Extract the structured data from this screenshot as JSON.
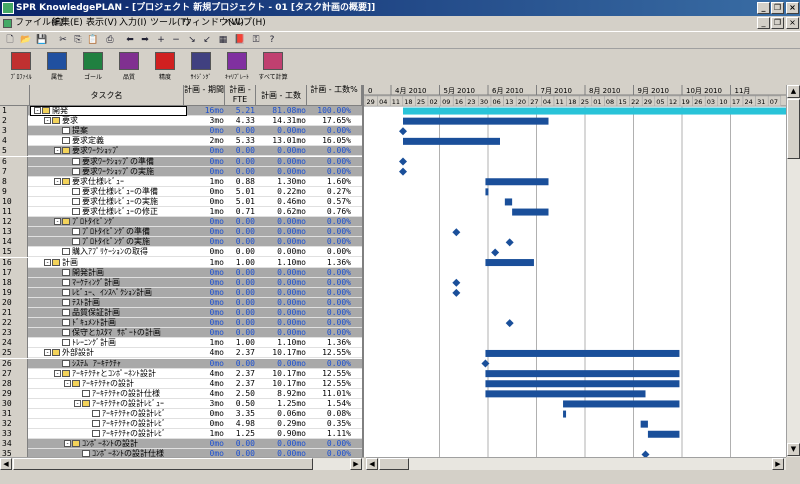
{
  "window": {
    "title": "SPR KnowledgePLAN - [プロジェクト 新規プロジェクト - 01 [タスク計画の概要]]",
    "minimize": "_",
    "restore": "❐",
    "close": "×",
    "doc_minimize": "_",
    "doc_restore": "❐",
    "doc_close": "×"
  },
  "menu": [
    {
      "label": "ファイル(F)"
    },
    {
      "label": "編集(E)"
    },
    {
      "label": "表示(V)"
    },
    {
      "label": "入力(I)"
    },
    {
      "label": "ツール(T)"
    },
    {
      "label": "ウィンドウ(W)"
    },
    {
      "label": "ヘルプ(H)"
    }
  ],
  "toolbar_icons": [
    {
      "name": "new-icon",
      "glyph": "🗋"
    },
    {
      "name": "open-icon",
      "glyph": "📂"
    },
    {
      "name": "save-icon",
      "glyph": "💾"
    },
    {
      "name": "cut-icon",
      "glyph": "✂"
    },
    {
      "name": "copy-icon",
      "glyph": "⎘"
    },
    {
      "name": "paste-icon",
      "glyph": "📋"
    },
    {
      "name": "print-icon",
      "glyph": "⎙"
    },
    {
      "name": "arrow-left-icon",
      "glyph": "⬅"
    },
    {
      "name": "arrow-right-icon",
      "glyph": "➡"
    },
    {
      "name": "add-icon",
      "glyph": "+"
    },
    {
      "name": "remove-icon",
      "glyph": "−"
    },
    {
      "name": "indent-icon",
      "glyph": "↘"
    },
    {
      "name": "outdent-icon",
      "glyph": "↙"
    },
    {
      "name": "calculator-icon",
      "glyph": "▦"
    },
    {
      "name": "book-icon",
      "glyph": "📕"
    },
    {
      "name": "key-icon",
      "glyph": "⚿"
    },
    {
      "name": "help-icon",
      "glyph": "?"
    }
  ],
  "big_buttons": [
    {
      "label": "ﾌﾟﾛﾌｧｲﾙ",
      "color": "#c03030",
      "icon": "profile-icon"
    },
    {
      "label": "属性",
      "color": "#2050a0",
      "icon": "attributes-icon"
    },
    {
      "label": "ゴール",
      "color": "#208040",
      "icon": "goal-icon"
    },
    {
      "label": "品質",
      "color": "#803090",
      "icon": "quality-icon"
    },
    {
      "label": "精度",
      "color": "#d02020",
      "icon": "precision-icon"
    },
    {
      "label": "ｻｲｼﾞﾝｸﾞ",
      "color": "#404080",
      "icon": "sizing-icon"
    },
    {
      "label": "ｷｬﾘﾌﾞﾚｰﾄ",
      "color": "#8030a0",
      "icon": "calibrate-icon"
    },
    {
      "label": "すべて計算",
      "color": "#c04070",
      "icon": "calculate-all-icon"
    }
  ],
  "grid": {
    "columns": [
      {
        "label": "タスク名"
      },
      {
        "label": "計画 - 期間"
      },
      {
        "label": "計画 - FTE"
      },
      {
        "label": "計画 - 工数"
      },
      {
        "label": "計画 - 工数%"
      }
    ],
    "rows": [
      {
        "num": "1",
        "level": 0,
        "icon": "folder",
        "exp": "-",
        "summary": true,
        "name": "開発",
        "dur": "16mo",
        "fte": "5.21",
        "work": "81.08mo",
        "pct": "100.00%"
      },
      {
        "num": "2",
        "level": 1,
        "icon": "folder",
        "exp": "-",
        "summary": false,
        "name": "要求",
        "dur": "3mo",
        "fte": "4.33",
        "work": "14.31mo",
        "pct": "17.65%"
      },
      {
        "num": "3",
        "level": 2,
        "icon": "doc",
        "exp": "",
        "summary": true,
        "name": "提案",
        "dur": "0mo",
        "fte": "0.00",
        "work": "0.00mo",
        "pct": "0.00%"
      },
      {
        "num": "4",
        "level": 2,
        "icon": "doc",
        "exp": "",
        "summary": false,
        "name": "要求定義",
        "dur": "2mo",
        "fte": "5.33",
        "work": "13.01mo",
        "pct": "16.05%"
      },
      {
        "num": "5",
        "level": 2,
        "icon": "folder",
        "exp": "-",
        "summary": true,
        "name": "要求ﾜｰｸｼｮｯﾌﾟ",
        "dur": "0mo",
        "fte": "0.00",
        "work": "0.00mo",
        "pct": "0.00%"
      },
      {
        "num": "6",
        "level": 3,
        "icon": "doc",
        "exp": "",
        "summary": true,
        "name": "要求ﾜｰｸｼｮｯﾌﾟの準備",
        "dur": "0mo",
        "fte": "0.00",
        "work": "0.00mo",
        "pct": "0.00%"
      },
      {
        "num": "7",
        "level": 3,
        "icon": "doc",
        "exp": "",
        "summary": true,
        "name": "要求ﾜｰｸｼｮｯﾌﾟの実施",
        "dur": "0mo",
        "fte": "0.00",
        "work": "0.00mo",
        "pct": "0.00%"
      },
      {
        "num": "8",
        "level": 2,
        "icon": "folder",
        "exp": "-",
        "summary": false,
        "name": "要求仕様ﾚﾋﾞｭｰ",
        "dur": "1mo",
        "fte": "0.88",
        "work": "1.30mo",
        "pct": "1.60%"
      },
      {
        "num": "9",
        "level": 3,
        "icon": "doc",
        "exp": "",
        "summary": false,
        "name": "要求仕様ﾚﾋﾞｭｰの準備",
        "dur": "0mo",
        "fte": "5.01",
        "work": "0.22mo",
        "pct": "0.27%"
      },
      {
        "num": "10",
        "level": 3,
        "icon": "doc",
        "exp": "",
        "summary": false,
        "name": "要求仕様ﾚﾋﾞｭｰの実施",
        "dur": "0mo",
        "fte": "5.01",
        "work": "0.46mo",
        "pct": "0.57%"
      },
      {
        "num": "11",
        "level": 3,
        "icon": "doc",
        "exp": "",
        "summary": false,
        "name": "要求仕様ﾚﾋﾞｭｰの修正",
        "dur": "1mo",
        "fte": "0.71",
        "work": "0.62mo",
        "pct": "0.76%"
      },
      {
        "num": "12",
        "level": 2,
        "icon": "folder",
        "exp": "-",
        "summary": true,
        "name": "ﾌﾟﾛﾄﾀｲﾋﾟﾝｸﾞ",
        "dur": "0mo",
        "fte": "0.00",
        "work": "0.00mo",
        "pct": "0.00%"
      },
      {
        "num": "13",
        "level": 3,
        "icon": "doc",
        "exp": "",
        "summary": true,
        "name": "ﾌﾟﾛﾄﾀｲﾋﾟﾝｸﾞの準備",
        "dur": "0mo",
        "fte": "0.00",
        "work": "0.00mo",
        "pct": "0.00%"
      },
      {
        "num": "14",
        "level": 3,
        "icon": "doc",
        "exp": "",
        "summary": true,
        "name": "ﾌﾟﾛﾄﾀｲﾋﾟﾝｸﾞの実施",
        "dur": "0mo",
        "fte": "0.00",
        "work": "0.00mo",
        "pct": "0.00%"
      },
      {
        "num": "15",
        "level": 2,
        "icon": "doc",
        "exp": "",
        "summary": false,
        "name": "購入ｱﾌﾟﾘｹｰｼｮﾝの取得",
        "dur": "0mo",
        "fte": "0.00",
        "work": "0.00mo",
        "pct": "0.00%"
      },
      {
        "num": "16",
        "level": 1,
        "icon": "folder",
        "exp": "-",
        "summary": false,
        "name": "計画",
        "dur": "1mo",
        "fte": "1.00",
        "work": "1.10mo",
        "pct": "1.36%"
      },
      {
        "num": "17",
        "level": 2,
        "icon": "doc",
        "exp": "",
        "summary": true,
        "name": "開発計画",
        "dur": "0mo",
        "fte": "0.00",
        "work": "0.00mo",
        "pct": "0.00%"
      },
      {
        "num": "18",
        "level": 2,
        "icon": "doc",
        "exp": "",
        "summary": true,
        "name": "ﾏｰｹﾃｨﾝｸﾞ計画",
        "dur": "0mo",
        "fte": "0.00",
        "work": "0.00mo",
        "pct": "0.00%"
      },
      {
        "num": "19",
        "level": 2,
        "icon": "doc",
        "exp": "",
        "summary": true,
        "name": "ﾚﾋﾞｭｰ、ｲﾝｽﾍﾟｸｼｮﾝ計画",
        "dur": "0mo",
        "fte": "0.00",
        "work": "0.00mo",
        "pct": "0.00%"
      },
      {
        "num": "20",
        "level": 2,
        "icon": "doc",
        "exp": "",
        "summary": true,
        "name": "ﾃｽﾄ計画",
        "dur": "0mo",
        "fte": "0.00",
        "work": "0.00mo",
        "pct": "0.00%"
      },
      {
        "num": "21",
        "level": 2,
        "icon": "doc",
        "exp": "",
        "summary": true,
        "name": "品質保証計画",
        "dur": "0mo",
        "fte": "0.00",
        "work": "0.00mo",
        "pct": "0.00%"
      },
      {
        "num": "22",
        "level": 2,
        "icon": "doc",
        "exp": "",
        "summary": true,
        "name": "ﾄﾞｷｭﾒﾝﾄ計画",
        "dur": "0mo",
        "fte": "0.00",
        "work": "0.00mo",
        "pct": "0.00%"
      },
      {
        "num": "23",
        "level": 2,
        "icon": "doc",
        "exp": "",
        "summary": true,
        "name": "保守とｶｽﾀﾏ ｻﾎﾟｰﾄの計画",
        "dur": "0mo",
        "fte": "0.00",
        "work": "0.00mo",
        "pct": "0.00%"
      },
      {
        "num": "24",
        "level": 2,
        "icon": "doc",
        "exp": "",
        "summary": false,
        "name": "ﾄﾚｰﾆﾝｸﾞ計画",
        "dur": "1mo",
        "fte": "1.00",
        "work": "1.10mo",
        "pct": "1.36%"
      },
      {
        "num": "25",
        "level": 1,
        "icon": "folder",
        "exp": "-",
        "summary": false,
        "name": "外部設計",
        "dur": "4mo",
        "fte": "2.37",
        "work": "10.17mo",
        "pct": "12.55%"
      },
      {
        "num": "26",
        "level": 2,
        "icon": "doc",
        "exp": "",
        "summary": true,
        "name": "ｼｽﾃﾑ ｱｰｷﾃｸﾁｬ",
        "dur": "0mo",
        "fte": "0.00",
        "work": "0.00mo",
        "pct": "0.00%"
      },
      {
        "num": "27",
        "level": 2,
        "icon": "folder",
        "exp": "-",
        "summary": false,
        "name": "ｱｰｷﾃｸﾁｬとｺﾝﾎﾟｰﾈﾝﾄ設計",
        "dur": "4mo",
        "fte": "2.37",
        "work": "10.17mo",
        "pct": "12.55%"
      },
      {
        "num": "28",
        "level": 3,
        "icon": "folder",
        "exp": "-",
        "summary": false,
        "name": "ｱｰｷﾃｸﾁｬの設計",
        "dur": "4mo",
        "fte": "2.37",
        "work": "10.17mo",
        "pct": "12.55%"
      },
      {
        "num": "29",
        "level": 4,
        "icon": "doc",
        "exp": "",
        "summary": false,
        "name": "ｱｰｷﾃｸﾁｬの設計仕様",
        "dur": "4mo",
        "fte": "2.50",
        "work": "8.92mo",
        "pct": "11.01%"
      },
      {
        "num": "30",
        "level": 4,
        "icon": "folder",
        "exp": "-",
        "summary": false,
        "name": "ｱｰｷﾃｸﾁｬの設計ﾚﾋﾞｭｰ",
        "dur": "3mo",
        "fte": "0.50",
        "work": "1.25mo",
        "pct": "1.54%"
      },
      {
        "num": "31",
        "level": 5,
        "icon": "doc",
        "exp": "",
        "summary": false,
        "name": "ｱｰｷﾃｸﾁｬの設計ﾚﾋﾞ",
        "dur": "0mo",
        "fte": "3.35",
        "work": "0.06mo",
        "pct": "0.08%"
      },
      {
        "num": "32",
        "level": 5,
        "icon": "doc",
        "exp": "",
        "summary": false,
        "name": "ｱｰｷﾃｸﾁｬの設計ﾚﾋﾞ",
        "dur": "0mo",
        "fte": "4.98",
        "work": "0.29mo",
        "pct": "0.35%"
      },
      {
        "num": "33",
        "level": 5,
        "icon": "doc",
        "exp": "",
        "summary": false,
        "name": "ｱｰｷﾃｸﾁｬの設計ﾚﾋﾞ",
        "dur": "1mo",
        "fte": "1.25",
        "work": "0.90mo",
        "pct": "1.11%"
      },
      {
        "num": "34",
        "level": 3,
        "icon": "folder",
        "exp": "-",
        "summary": true,
        "name": "ｺﾝﾎﾟｰﾈﾝﾄの設計",
        "dur": "0mo",
        "fte": "0.00",
        "work": "0.00mo",
        "pct": "0.00%"
      },
      {
        "num": "35",
        "level": 4,
        "icon": "doc",
        "exp": "",
        "summary": true,
        "name": "ｺﾝﾎﾟｰﾈﾝﾄの設計仕様",
        "dur": "0mo",
        "fte": "0.00",
        "work": "0.00mo",
        "pct": "0.00%"
      }
    ]
  },
  "gantt": {
    "colors": {
      "bar": "#1a4f9a",
      "top_bar": "#29c3d8",
      "milestone": "#1a4f9a",
      "grid": "#b0b0b0"
    },
    "header_top": [
      "0",
      "4月 2010",
      "5月 2010",
      "6月 2010",
      "7月 2010",
      "8月 2010",
      "9月 2010",
      "10月 2010",
      "11月"
    ],
    "header_bottom": [
      "29",
      "04",
      "11",
      "18",
      "25",
      "02",
      "09",
      "16",
      "23",
      "30",
      "06",
      "13",
      "20",
      "27",
      "04",
      "11",
      "18",
      "25",
      "01",
      "08",
      "15",
      "22",
      "29",
      "05",
      "12",
      "19",
      "26",
      "03",
      "10",
      "17",
      "24",
      "31",
      "07"
    ],
    "tasks": [
      {
        "row": 1,
        "type": "bar",
        "start": 0.0,
        "end": 16.0,
        "top": true
      },
      {
        "row": 2,
        "type": "bar",
        "start": 0.0,
        "end": 3.0
      },
      {
        "row": 3,
        "type": "milestone",
        "at": 0.0
      },
      {
        "row": 4,
        "type": "bar",
        "start": 0.0,
        "end": 2.0
      },
      {
        "row": 6,
        "type": "milestone",
        "at": 0.0
      },
      {
        "row": 7,
        "type": "milestone",
        "at": 0.0
      },
      {
        "row": 8,
        "type": "bar",
        "start": 1.7,
        "end": 3.0
      },
      {
        "row": 9,
        "type": "bar",
        "start": 1.7,
        "end": 1.75
      },
      {
        "row": 10,
        "type": "bar",
        "start": 2.1,
        "end": 2.25
      },
      {
        "row": 11,
        "type": "bar",
        "start": 2.25,
        "end": 3.0
      },
      {
        "row": 13,
        "type": "milestone",
        "at": 1.1
      },
      {
        "row": 14,
        "type": "milestone",
        "at": 2.2
      },
      {
        "row": 15,
        "type": "milestone",
        "at": 1.9
      },
      {
        "row": 16,
        "type": "bar",
        "start": 1.7,
        "end": 2.7
      },
      {
        "row": 18,
        "type": "milestone",
        "at": 1.1
      },
      {
        "row": 19,
        "type": "milestone",
        "at": 1.1
      },
      {
        "row": 22,
        "type": "milestone",
        "at": 2.2
      },
      {
        "row": 25,
        "type": "bar",
        "start": 1.7,
        "end": 5.7
      },
      {
        "row": 26,
        "type": "milestone",
        "at": 1.7
      },
      {
        "row": 27,
        "type": "bar",
        "start": 1.7,
        "end": 5.7
      },
      {
        "row": 28,
        "type": "bar",
        "start": 1.7,
        "end": 5.7
      },
      {
        "row": 29,
        "type": "bar",
        "start": 1.7,
        "end": 5.0
      },
      {
        "row": 30,
        "type": "bar",
        "start": 3.3,
        "end": 5.7
      },
      {
        "row": 31,
        "type": "bar",
        "start": 3.3,
        "end": 3.35
      },
      {
        "row": 32,
        "type": "bar",
        "start": 4.9,
        "end": 5.05
      },
      {
        "row": 33,
        "type": "bar",
        "start": 5.05,
        "end": 5.7
      },
      {
        "row": 35,
        "type": "milestone",
        "at": 5.0
      }
    ]
  },
  "scroll": {
    "up": "▲",
    "down": "▼",
    "left": "◀",
    "right": "▶"
  }
}
